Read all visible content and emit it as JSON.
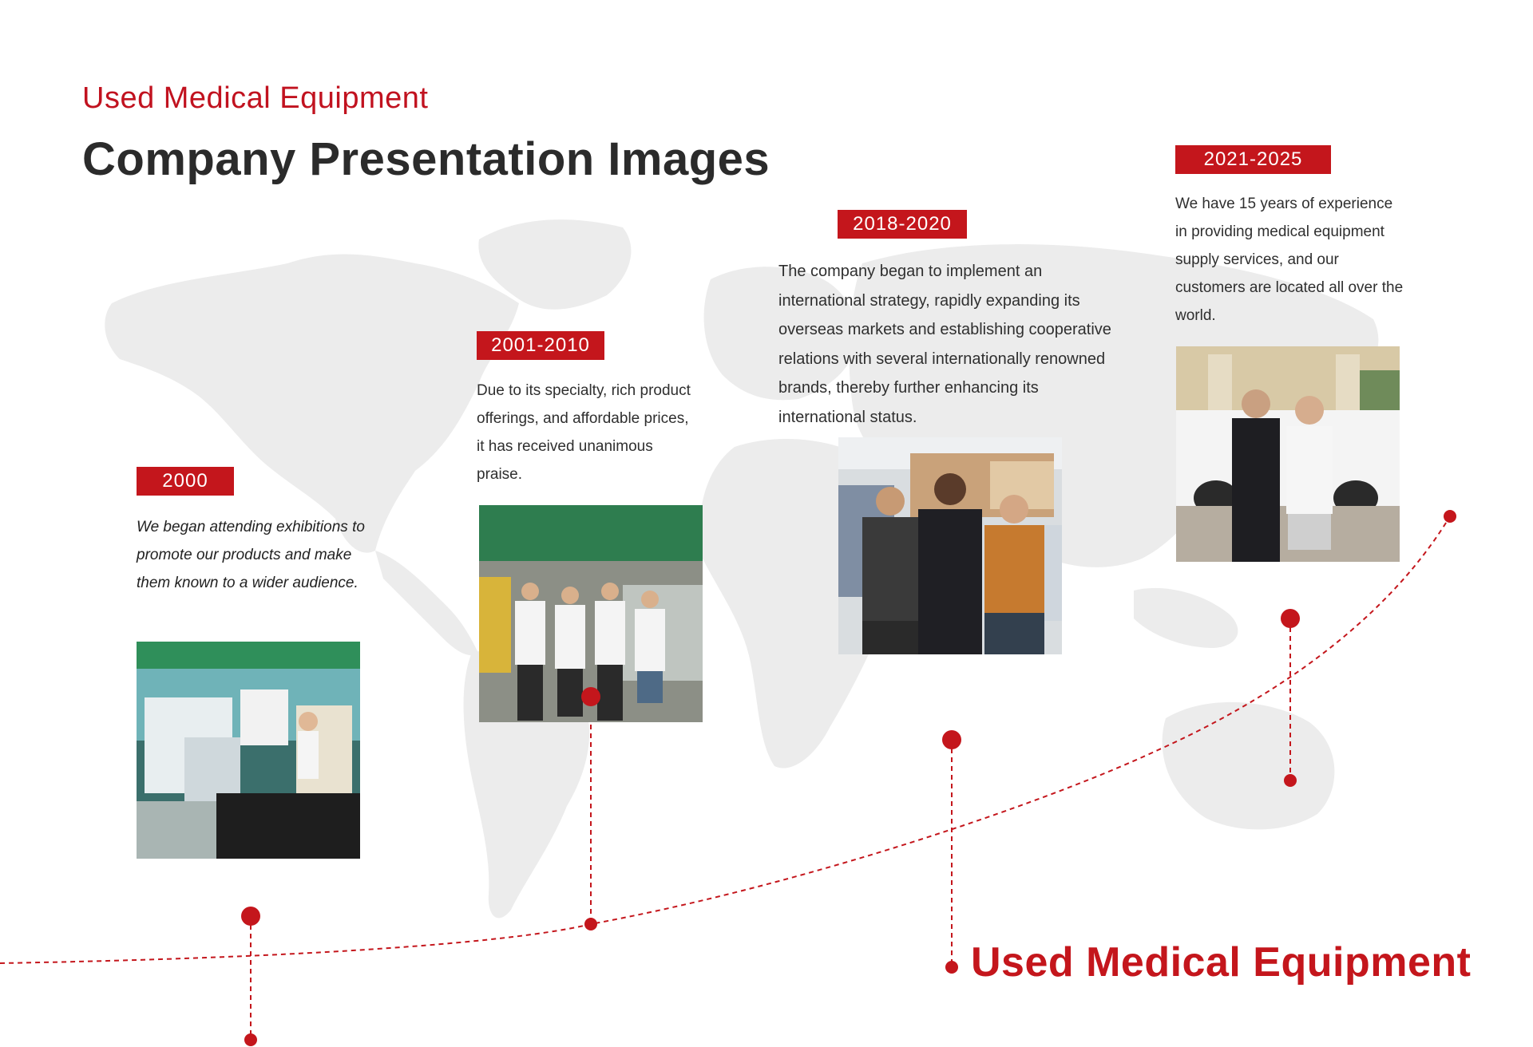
{
  "header": {
    "subtitle": "Used Medical Equipment",
    "title": "Company Presentation Images"
  },
  "milestones": [
    {
      "year": "2000",
      "description": "We began attending exhibitions to promote our products and make them known to a wider audience.",
      "photo": "exhibition booth with medical ultrasound equipment"
    },
    {
      "year": "2001-2010",
      "description": "Due to its specialty, rich product offerings, and affordable prices, it has received unanimous praise.",
      "photo": "four staff members standing at company exhibition booth"
    },
    {
      "year": "2018-2020",
      "description": "The company began to implement an international strategy, rapidly expanding its overseas markets and establishing cooperative relations with several internationally renowned brands, thereby further enhancing its international status.",
      "photo": "three people giving thumbs up in equipment warehouse"
    },
    {
      "year": "2021-2025",
      "description": "We have 15 years of experience in providing medical equipment supply services, and our customers are located all over the world.",
      "photo": "two men giving thumbs up in front of a white car"
    }
  ],
  "footer": {
    "brand": "Used Medical Equipment"
  },
  "colors": {
    "accent": "#c4161c",
    "title": "#2b2b2b",
    "map": "#ececec"
  }
}
